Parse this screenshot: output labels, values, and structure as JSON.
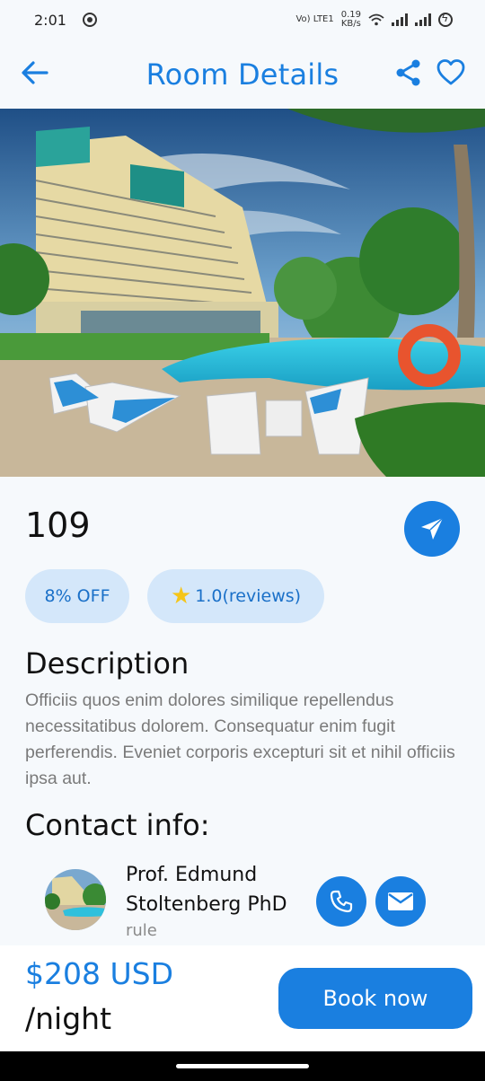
{
  "status_bar": {
    "time": "2:01",
    "network_top": "0.19",
    "network_bottom": "KB/s",
    "volte": "Vo) LTE1"
  },
  "header": {
    "title": "Room Details"
  },
  "room": {
    "number": "109",
    "discount": "8% OFF",
    "rating": "1.0(reviews)"
  },
  "description": {
    "heading": "Description",
    "text": "Officiis quos enim dolores similique repellendus necessitatibus dolorem. Consequatur enim fugit perferendis. Eveniet corporis excepturi sit et nihil officiis ipsa aut."
  },
  "contact": {
    "heading": "Contact info:",
    "name": "Prof. Edmund Stoltenberg PhD",
    "role": "rule"
  },
  "booking": {
    "price": "$208 USD",
    "unit": "/night",
    "book_label": "Book now"
  },
  "colors": {
    "accent": "#1a7fe0",
    "chip_bg": "#d4e7fa",
    "star": "#f5c518"
  }
}
